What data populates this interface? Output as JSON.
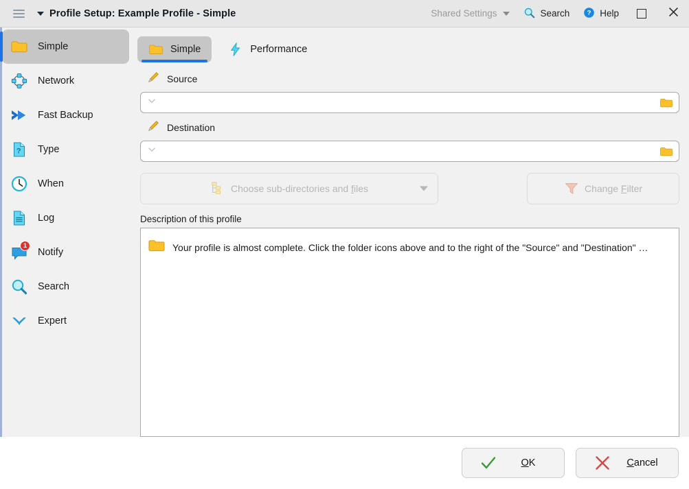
{
  "titlebar": {
    "menu_icon": "hamburger-icon",
    "caret_icon": "chevron-down-icon",
    "title": "Profile Setup: Example Profile - Simple",
    "shared_settings_label": "Shared Settings",
    "search_label": "Search",
    "help_label": "Help",
    "maximize_icon": "maximize-icon",
    "close_icon": "close-icon"
  },
  "sidebar": {
    "items": [
      {
        "label": "Simple",
        "icon": "folder-icon",
        "active": true
      },
      {
        "label": "Network",
        "icon": "network-nodes-icon",
        "active": false
      },
      {
        "label": "Fast Backup",
        "icon": "fast-forward-icon",
        "active": false
      },
      {
        "label": "Type",
        "icon": "file-question-icon",
        "active": false
      },
      {
        "label": "When",
        "icon": "clock-icon",
        "active": false
      },
      {
        "label": "Log",
        "icon": "document-icon",
        "active": false
      },
      {
        "label": "Notify",
        "icon": "speech-bubble-icon",
        "active": false,
        "badge": "1"
      },
      {
        "label": "Search",
        "icon": "magnifier-icon",
        "active": false
      },
      {
        "label": "Expert",
        "icon": "chevron-double-down-icon",
        "active": false
      }
    ]
  },
  "main": {
    "tabs": [
      {
        "label": "Simple",
        "icon": "folder-icon",
        "active": true
      },
      {
        "label": "Performance",
        "icon": "lightning-icon",
        "active": false
      }
    ],
    "source": {
      "label": "Source",
      "label_icon": "pencil-icon",
      "value": "",
      "placeholder": "",
      "dropdown_icon": "chevron-down-icon",
      "browse_icon": "folder-icon"
    },
    "destination": {
      "label": "Destination",
      "label_icon": "pencil-icon",
      "value": "",
      "placeholder": "",
      "dropdown_icon": "chevron-down-icon",
      "browse_icon": "folder-icon"
    },
    "choose_subdirs": {
      "label": "Choose sub-directories and files",
      "accel": "f",
      "icon": "folder-tree-icon",
      "dropdown_icon": "caret-down-icon",
      "disabled": true
    },
    "change_filter": {
      "label": "Change Filter",
      "accel": "F",
      "icon": "funnel-icon",
      "disabled": true
    },
    "description": {
      "label": "Description of this profile",
      "icon": "folder-icon",
      "text": "Your profile is almost complete. Click the folder icons above and to the right of the \"Source\" and \"Destination\" …"
    }
  },
  "footer": {
    "ok": {
      "label_before": "",
      "accel": "O",
      "label_after": "K",
      "icon": "check-icon"
    },
    "cancel": {
      "label_before": "",
      "accel": "C",
      "label_after": "ancel",
      "icon": "cross-icon"
    }
  },
  "colors": {
    "accent_blue": "#1a73e8",
    "folder_yellow": "#fcc12a",
    "cyan": "#3fc6f0",
    "badge_red": "#e03131",
    "ok_green": "#3a9a3a",
    "cancel_red": "#d24a43"
  }
}
